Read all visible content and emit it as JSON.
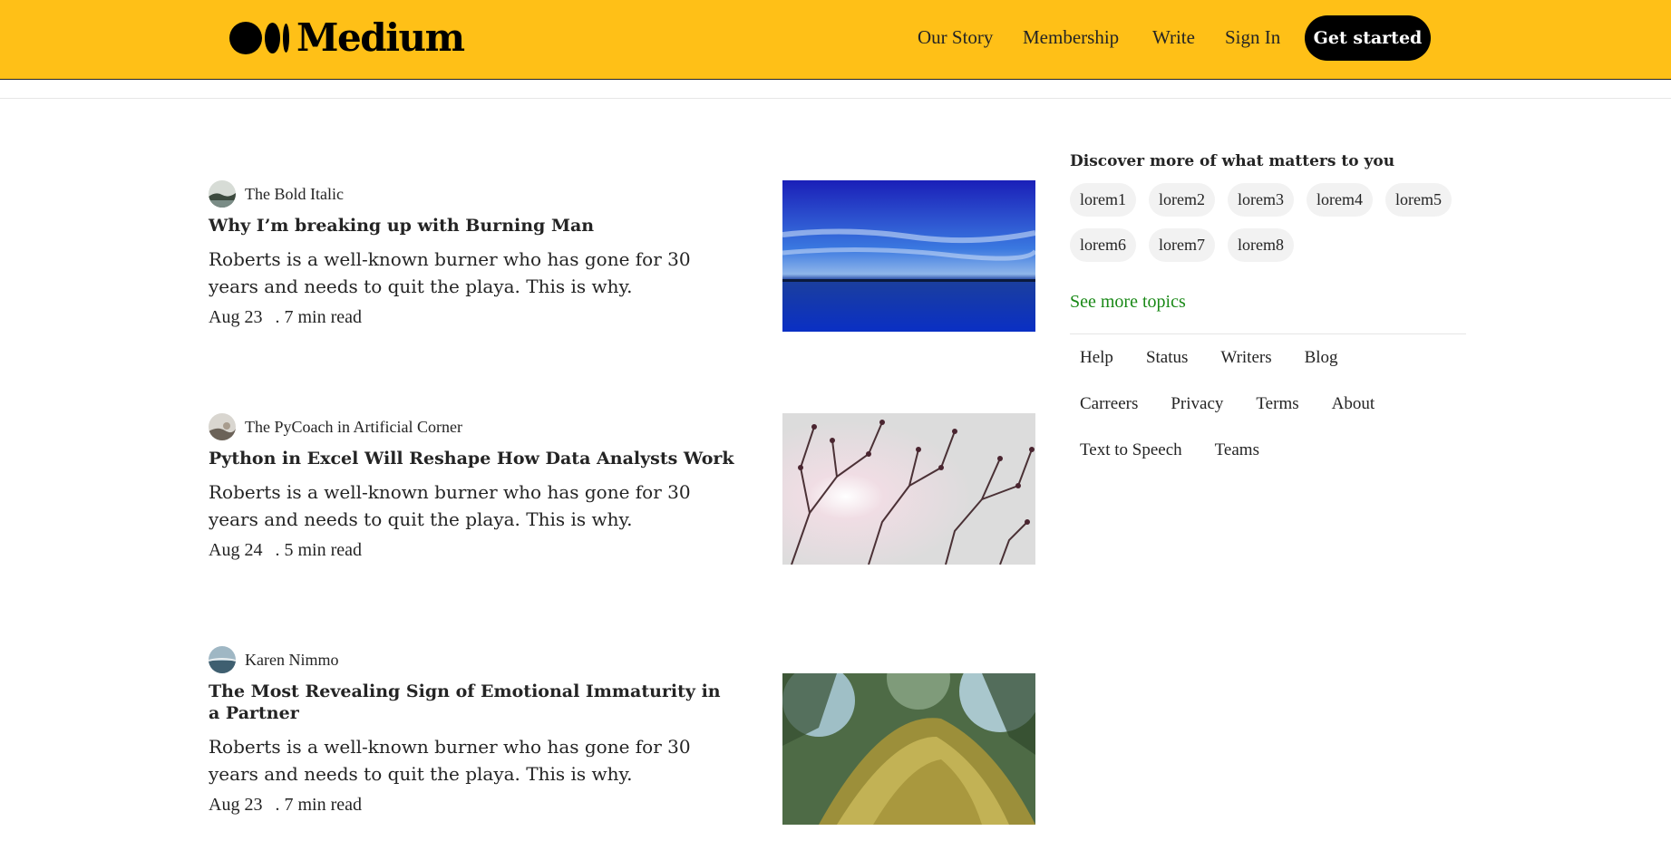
{
  "header": {
    "logo_text": "Medium",
    "nav": [
      "Our Story",
      "Membership",
      "Write",
      "Sign In"
    ],
    "cta_label": "Get started",
    "bg_color": "#ffc017"
  },
  "articles": [
    {
      "author": "The Bold Italic",
      "title": "Why I’m breaking up with Burning Man",
      "description": "Roberts is a well-known burner who has gone for 30 years and needs to quit the playa. This is why.",
      "date": "Aug 23",
      "read_time": ". 7 min read"
    },
    {
      "author": "The PyCoach in Artificial Corner",
      "title": "Python in Excel Will Reshape How Data Analysts Work",
      "description": "Roberts is a well-known burner who has gone for 30 years and needs to quit the playa. This is why.",
      "date": "Aug 24",
      "read_time": ". 5 min read"
    },
    {
      "author": "Karen Nimmo",
      "title": "The Most Revealing Sign of Emotional Immaturity in a Partner",
      "description": "Roberts is a well-known burner who has gone for 30 years and needs to quit the playa. This is why.",
      "date": "Aug 23",
      "read_time": ". 7 min read"
    }
  ],
  "sidebar": {
    "heading": "Discover more of what matters to you",
    "tags": [
      "lorem1",
      "lorem2",
      "lorem3",
      "lorem4",
      "lorem5",
      "lorem6",
      "lorem7",
      "lorem8"
    ],
    "see_more": "See more topics",
    "see_more_color": "#1a8917",
    "footer_links": [
      "Help",
      "Status",
      "Writers",
      "Blog",
      "Carreers",
      "Privacy",
      "Terms",
      "About",
      "Text to Speech",
      "Teams"
    ]
  }
}
